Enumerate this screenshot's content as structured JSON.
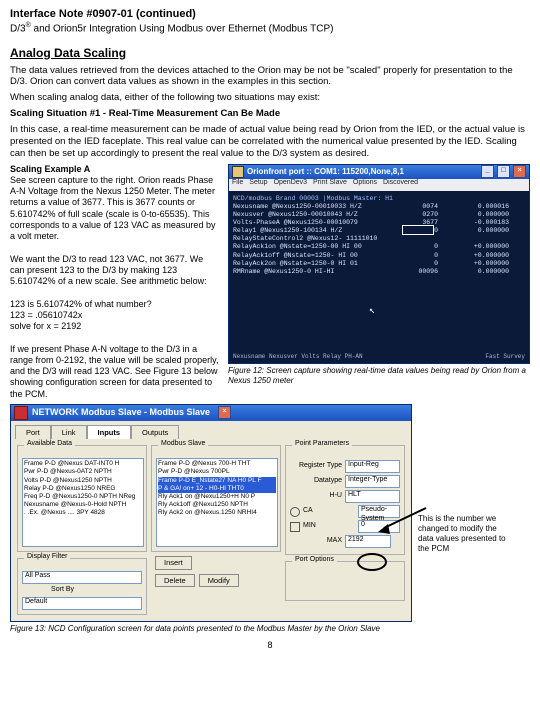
{
  "header": {
    "title": "Interface Note #0907-01 (continued)",
    "subtitle_pre": "D/3",
    "subtitle_sup": "®",
    "subtitle_post": " and Orion5r Integration Using Modbus over Ethernet (Modbus TCP)"
  },
  "section_heading": "Analog Data Scaling",
  "intro_p1": "The data values retrieved from the devices attached to the Orion may be not be \"scaled\" properly for presentation to the D/3. Orion can convert data values as shown in the examples in this section.",
  "intro_p2": "When scaling analog data, either of the following two situations may exist:",
  "situation_heading": "Scaling Situation #1 - Real-Time Measurement Can Be Made",
  "situation_body": "In this case, a real-time measurement can be made of actual value being read by Orion from the IED, or the actual value is presented on the IED faceplate. This real value can be correlated with the numerical value presented by the IED. Scaling can then be set up accordingly to present the real value to the D/3 system as desired.",
  "exampleA": {
    "heading": "Scaling Example A",
    "p1": "See screen capture to the right. Orion reads Phase A-N Voltage from the Nexus 1250 Meter. The meter returns a value of 3677. This is 3677 counts or 5.610742% of full scale (scale is 0-to-65535). This corresponds to a value of 123 VAC as measured by a volt meter.",
    "p2": "We want the D/3 to read 123 VAC, not 3677. We can present 123 to the D/3 by making 123 5.610742% of a new scale. See arithmetic below:",
    "calc1": "123 is 5.610742% of what number?",
    "calc2": "123 = .05610742x",
    "calc3": "solve for x = 2192",
    "p3": "If we present Phase A-N voltage to the D/3 in a range from 0-2192, the value will be scaled properly, and the D/3 will read 123 VAC. See Figure 13 below showing configuration screen for data presented to the PCM."
  },
  "terminal": {
    "title": "Orionfront port :: COM1: 115200,None,8,1",
    "menu": [
      "File",
      "Setup",
      "OpenDev3",
      "Print Slave",
      "Options",
      "Discovered"
    ],
    "header_line": "NCD/modbus   Brand 00003   |Modbus Master: H1",
    "rows": [
      {
        "c1": "Nexusname @Nexus1250-00010033  H/Z",
        "c2": "0074",
        "c3": "0.000016"
      },
      {
        "c1": "Nexusver  @Nexus1250-00010043  H/Z",
        "c2": "0270",
        "c3": "0.000000"
      },
      {
        "c1": "Volts-PhaseA @Nexus1250-00010079",
        "c2": "3677",
        "c3": "-0.000183"
      },
      {
        "c1": "Relay1 @Nexus1250-100134  H/Z",
        "c2": "0",
        "c3": "0.000000"
      },
      {
        "c1": "RelayStateControl2 @Nexus12- 11111010",
        "c2": "",
        "c3": ""
      },
      {
        "c1": "RelayAck1on @Nstate=1250-00 HI  00",
        "c2": "0",
        "c3": "+0.000000"
      },
      {
        "c1": "RelayAck1off @Nstate=1250- HI 00",
        "c2": "0",
        "c3": "+0.000000"
      },
      {
        "c1": "RelayAck2on @Nstate=1250-0 HI 01",
        "c2": "0",
        "c3": "+0.000000"
      },
      {
        "c1": "RMRname      @Nexus1250-0 HI-HI",
        "c2": "00096",
        "c3": "0.000000"
      }
    ],
    "status_left": "Nexusname  Nexusver  Volts  Relay  PH-AN",
    "status_right": "Fast Survey"
  },
  "fig12_caption": "Figure 12: Screen capture showing real-time data values being read by Orion from a Nexus 1250 meter",
  "config": {
    "title": "NETWORK Modbus Slave - Modbus Slave",
    "tabs": [
      "Port",
      "Link",
      "Inputs",
      "Outputs"
    ],
    "left_group": "Available Data",
    "left_items": [
      "Frame P-D  @Nexus  DAT-INT0 H",
      "Pwr   P-D  @Nexus-0AT2   NPTH",
      "Volts P-D  @Nexus1250    NPTH",
      "Relay P-D  @Nexus1250    NREG",
      "Freq  P-D  @Nexus1250-0 NPTH NReg",
      "Nexusname @Nexus-0-Hold  NPTH",
      ".  .Ex.   @Nexus .... 3PY 4828"
    ],
    "mid_group": "Modbus Slave",
    "mid_items": [
      "Frame P-D  @Nexus   700-H THT",
      "Pwr   P-D  @Nexus       700PL",
      "Frame P-D  E_Nstate27 NA H0 PL F",
      "P & GA! on+ 12 - H0-HI THT0",
      "Rly Ack1 on @Nexu1250+H N0 P",
      "Rly Ack1off @Nexu1250  NPTH",
      "Rly Ack2 on @Nexus.1250 NRHI4"
    ],
    "right_group": "Point Parameters",
    "reg_type_label": "Register Type",
    "reg_type_value": "Input-Reg",
    "datatype_label": "Datatype",
    "datatype_value": "Integer-Type",
    "hu_label": "H-U",
    "hu_value": "HLT",
    "ca_label": "CA",
    "ca_value": "Pseudo-System",
    "min_label": "MIN",
    "min_value": "0",
    "max_label": "MAX",
    "max_value": "2192",
    "disp_group": "Display Filter",
    "disp_val": "All Pass",
    "sortby_label": "Sort By",
    "sortby_val": "Default",
    "port_group": "Port Options",
    "buttons": [
      "Insert",
      "Delete",
      "Modify"
    ]
  },
  "annotation_text": "This is the number we changed to modify the data values presented to the PCM",
  "fig13_caption": "Figure 13: NCD Configuration screen for data points presented to the Modbus Master by the Orion Slave",
  "page_number": "8"
}
